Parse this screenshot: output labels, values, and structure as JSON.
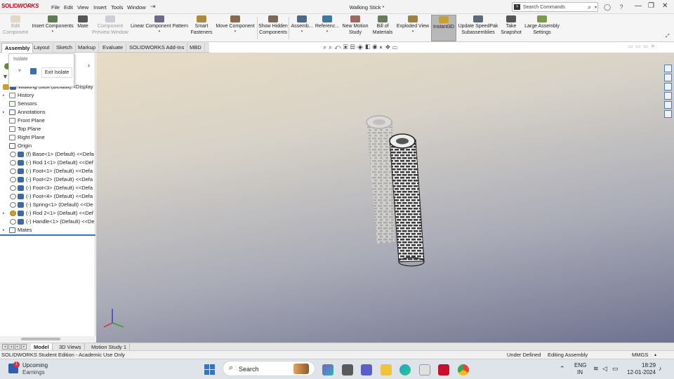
{
  "app": {
    "logo_brand": "SOLID",
    "logo_sub": "WORKS",
    "menus": [
      "File",
      "Edit",
      "View",
      "Insert",
      "Tools",
      "Window"
    ],
    "document_title": "Walking Stick *",
    "search_placeholder": "Search Commands"
  },
  "ribbon": {
    "buttons": [
      {
        "label": "Edit\nComponent",
        "disabled": true
      },
      {
        "label": "Insert Components",
        "disabled": false
      },
      {
        "label": "Mate",
        "disabled": false
      },
      {
        "label": "Component\nPreview Window",
        "disabled": true
      },
      {
        "label": "Linear Component Pattern",
        "disabled": false
      },
      {
        "label": "Smart\nFasteners",
        "disabled": false
      },
      {
        "label": "Move Component",
        "disabled": false
      },
      {
        "label": "Show Hidden\nComponents",
        "disabled": false
      },
      {
        "label": "Assemb...",
        "disabled": false
      },
      {
        "label": "Referenc...",
        "disabled": false
      },
      {
        "label": "New Motion\nStudy",
        "disabled": false
      },
      {
        "label": "Bill of\nMaterials",
        "disabled": false
      },
      {
        "label": "Exploded View",
        "disabled": false
      },
      {
        "label": "Instant3D",
        "disabled": false,
        "active": true
      },
      {
        "label": "Update SpeedPak\nSubassemblies",
        "disabled": false
      },
      {
        "label": "Take\nSnapshot",
        "disabled": false
      },
      {
        "label": "Large Assembly\nSettings",
        "disabled": false
      }
    ]
  },
  "command_tabs": [
    "Assembly",
    "Layout",
    "Sketch",
    "Markup",
    "Evaluate",
    "SOLIDWORKS Add-Ins",
    "MBD"
  ],
  "isolate_popup": {
    "title": "Isolate",
    "exit_label": "Exit Isolate"
  },
  "feature_tree": {
    "root": "Walking Stick (Default) <Display",
    "items": [
      {
        "label": "History",
        "type": "folder",
        "expand": true
      },
      {
        "label": "Sensors",
        "type": "sensor",
        "expand": false
      },
      {
        "label": "Annotations",
        "type": "annotation",
        "expand": true
      },
      {
        "label": "Front Plane",
        "type": "plane",
        "expand": false
      },
      {
        "label": "Top Plane",
        "type": "plane",
        "expand": false
      },
      {
        "label": "Right Plane",
        "type": "plane",
        "expand": false
      },
      {
        "label": "Origin",
        "type": "origin",
        "expand": false
      },
      {
        "label": "(f) Base<1> (Default) <<Defa",
        "type": "part",
        "expand": false
      },
      {
        "label": "(-) Rod 1<1> (Default) <<Def",
        "type": "part",
        "expand": false
      },
      {
        "label": "(-) Foot<1> (Default) <<Defa",
        "type": "part",
        "expand": false
      },
      {
        "label": "(-) Foot<2> (Default) <<Defa",
        "type": "part",
        "expand": false
      },
      {
        "label": "(-) Foot<3> (Default) <<Defa",
        "type": "part",
        "expand": false
      },
      {
        "label": "(-) Foot<4> (Default) <<Defa",
        "type": "part",
        "expand": false
      },
      {
        "label": "(-) Spring<1> (Default) <<De",
        "type": "part",
        "expand": false
      },
      {
        "label": "(-) Rod 2<1> (Default) <<Def",
        "type": "subasm",
        "expand": true
      },
      {
        "label": "(-) Handle<1> (Default) <<De",
        "type": "part",
        "expand": false
      },
      {
        "label": "Mates",
        "type": "mates",
        "expand": true
      }
    ]
  },
  "bottom_tabs": [
    "Model",
    "3D Views",
    "Motion Study 1"
  ],
  "status": {
    "edition": "SOLIDWORKS Student Edition - Academic Use Only",
    "state": "Under Defined",
    "mode": "Editing Assembly",
    "units": "MMGS"
  },
  "taskbar": {
    "weather_title": "Upcoming",
    "weather_sub": "Earnings",
    "weather_badge": "1",
    "search_label": "Search",
    "lang_top": "ENG",
    "lang_bottom": "IN",
    "time": "18:29",
    "date": "12-01-2024"
  },
  "colors": {
    "accent": "#2a7ac2",
    "brand": "#d0021b"
  }
}
